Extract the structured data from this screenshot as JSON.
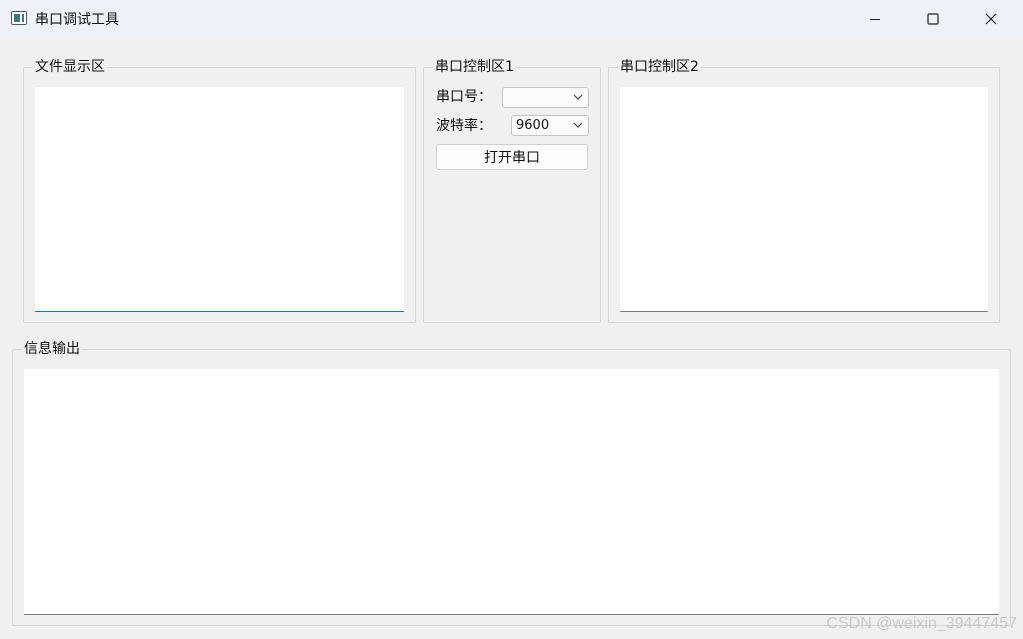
{
  "window": {
    "title": "串口调试工具",
    "icons": {
      "app": "app-window-icon",
      "minimize": "minimize-icon",
      "maximize": "maximize-icon",
      "close": "close-icon"
    }
  },
  "file_panel": {
    "title": "文件显示区"
  },
  "control1": {
    "title": "串口控制区1",
    "port_label": "串口号：",
    "port_value": "",
    "baud_label": "波特率：",
    "baud_value": "9600",
    "open_button": "打开串口"
  },
  "control2": {
    "title": "串口控制区2"
  },
  "output_panel": {
    "title": "信息输出"
  },
  "watermark": "CSDN @weixin_39447457",
  "colors": {
    "focus_accent": "#1f6fb5",
    "titlebar": "#eef1f6",
    "background": "#f0f0f0"
  }
}
